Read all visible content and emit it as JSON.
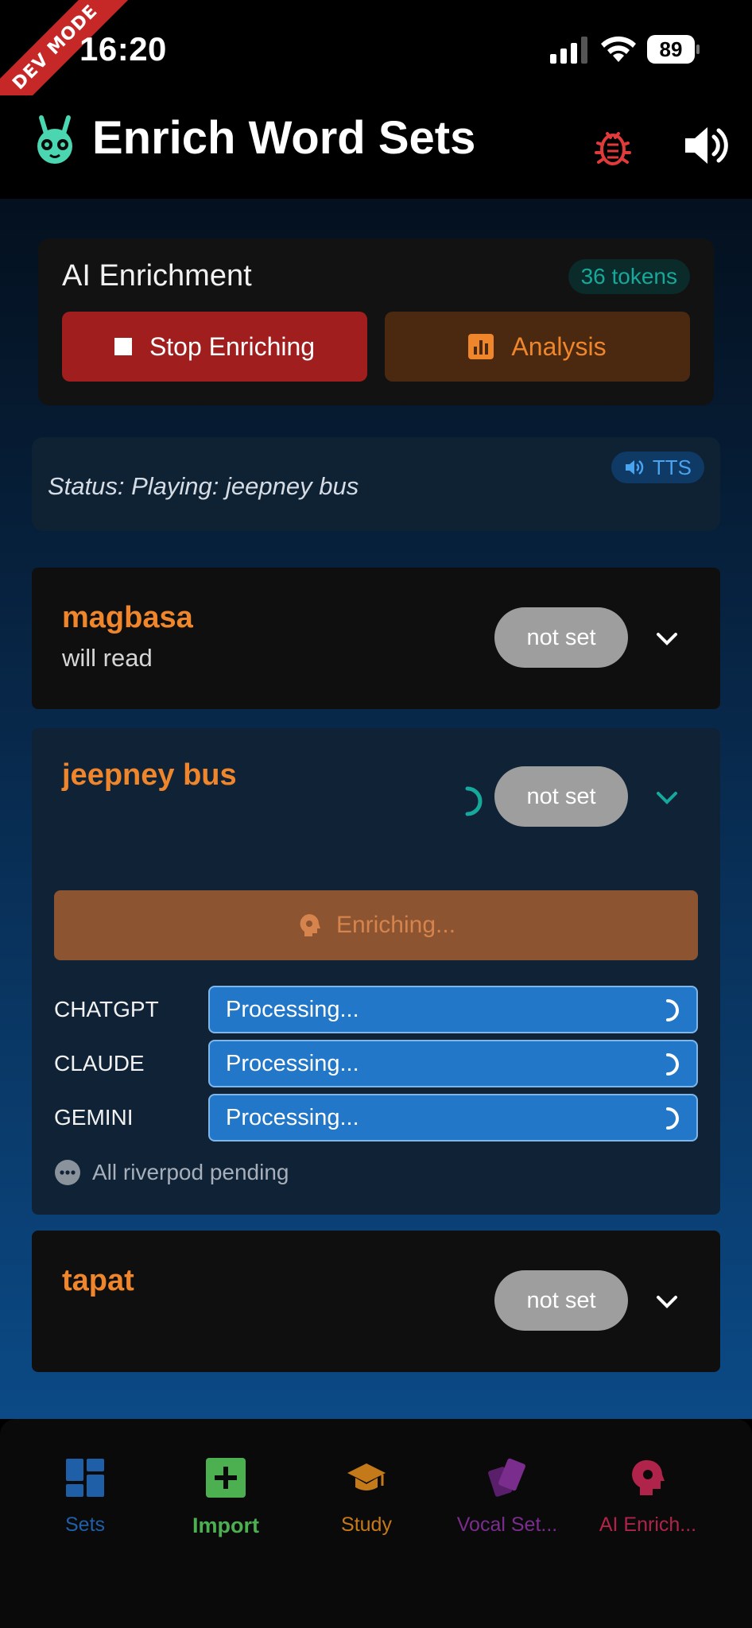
{
  "status_bar": {
    "time": "16:20",
    "battery": "89",
    "dev_banner": "DEV MODE"
  },
  "app_bar": {
    "title": "Enrich Word Sets",
    "bug_icon": "bug-icon",
    "sound_icon": "volume-icon"
  },
  "ai_card": {
    "title": "AI Enrichment",
    "tokens": "36 tokens",
    "stop_label": "Stop Enriching",
    "analysis_label": "Analysis"
  },
  "status": {
    "text": "Status: Playing: jeepney bus",
    "tts_label": "TTS"
  },
  "words": [
    {
      "word": "magbasa",
      "meaning": "will read",
      "status": "not set"
    },
    {
      "word": "jeepney bus",
      "meaning": "",
      "status": "not set"
    },
    {
      "word": "tapat",
      "meaning": "",
      "status": "not set"
    }
  ],
  "enrichment": {
    "button_label": "Enriching...",
    "providers": [
      {
        "name": "CHATGPT",
        "state": "Processing..."
      },
      {
        "name": "CLAUDE",
        "state": "Processing..."
      },
      {
        "name": "GEMINI",
        "state": "Processing..."
      }
    ],
    "pending_text": "All riverpod pending"
  },
  "bottom_nav": [
    {
      "label": "Sets",
      "color": "#1f5fa8"
    },
    {
      "label": "Import",
      "color": "#4caf50"
    },
    {
      "label": "Study",
      "color": "#c57a1a"
    },
    {
      "label": "Vocal Set...",
      "color": "#7b2d8e"
    },
    {
      "label": "AI Enrich...",
      "color": "#b0234a"
    }
  ],
  "colors": {
    "accent_orange": "#f0862b",
    "stop_red": "#a11e1f",
    "processing_blue": "#2277c8",
    "teal": "#16a89a"
  }
}
